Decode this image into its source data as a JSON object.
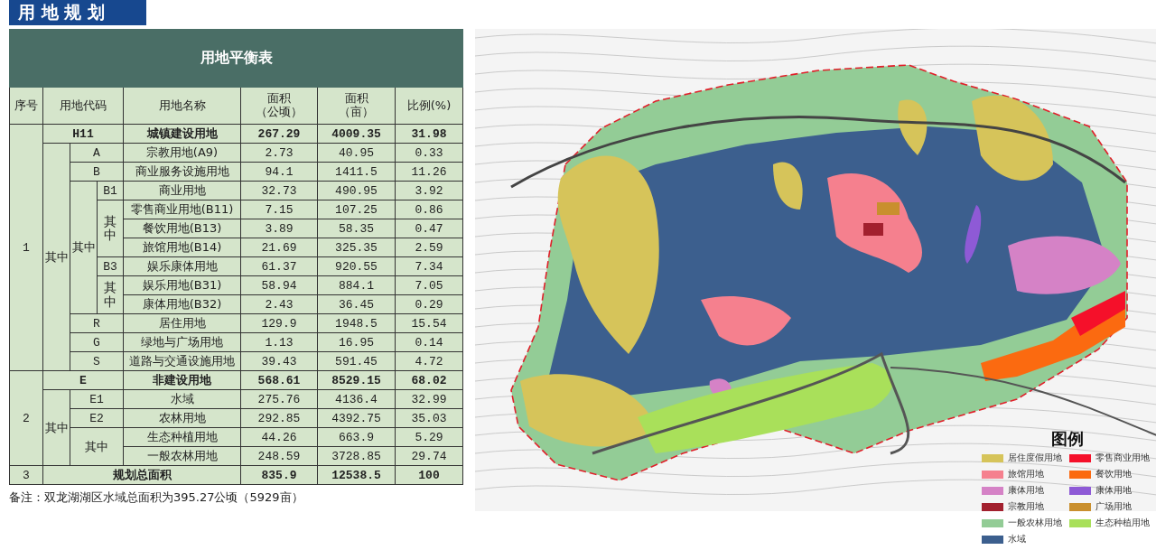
{
  "section_tab": {
    "title": "用 地 规 划"
  },
  "table": {
    "title": "用地平衡表",
    "columns": [
      {
        "label": "序号"
      },
      {
        "label": "用地代码"
      },
      {
        "label": "用地名称"
      },
      {
        "label": "面积",
        "unit": "（公顷）"
      },
      {
        "label": "面积",
        "unit": "（亩）"
      },
      {
        "label": "比例(%)"
      }
    ],
    "sections": [
      {
        "no": "1",
        "code": "H11",
        "name": "城镇建设用地",
        "area_ha": "267.29",
        "area_mu": "4009.35",
        "ratio": "31.98",
        "group_label": "其中",
        "children": [
          {
            "code": "A",
            "name": "宗教用地(A9)",
            "area_ha": "2.73",
            "area_mu": "40.95",
            "ratio": "0.33"
          },
          {
            "code": "B",
            "name": "商业服务设施用地",
            "area_ha": "94.1",
            "area_mu": "1411.5",
            "ratio": "11.26",
            "group_label": "其中",
            "children": [
              {
                "code": "B1",
                "name": "商业用地",
                "area_ha": "32.73",
                "area_mu": "490.95",
                "ratio": "3.92",
                "group_label": "其中",
                "children": [
                  {
                    "name": "零售商业用地(B11)",
                    "area_ha": "7.15",
                    "area_mu": "107.25",
                    "ratio": "0.86"
                  },
                  {
                    "name": "餐饮用地(B13)",
                    "area_ha": "3.89",
                    "area_mu": "58.35",
                    "ratio": "0.47"
                  },
                  {
                    "name": "旅馆用地(B14)",
                    "area_ha": "21.69",
                    "area_mu": "325.35",
                    "ratio": "2.59"
                  }
                ]
              },
              {
                "code": "B3",
                "name": "娱乐康体用地",
                "area_ha": "61.37",
                "area_mu": "920.55",
                "ratio": "7.34",
                "group_label": "其中",
                "children": [
                  {
                    "name": "娱乐用地(B31)",
                    "area_ha": "58.94",
                    "area_mu": "884.1",
                    "ratio": "7.05"
                  },
                  {
                    "name": "康体用地(B32)",
                    "area_ha": "2.43",
                    "area_mu": "36.45",
                    "ratio": "0.29"
                  }
                ]
              }
            ]
          },
          {
            "code": "R",
            "name": "居住用地",
            "area_ha": "129.9",
            "area_mu": "1948.5",
            "ratio": "15.54"
          },
          {
            "code": "G",
            "name": "绿地与广场用地",
            "area_ha": "1.13",
            "area_mu": "16.95",
            "ratio": "0.14"
          },
          {
            "code": "S",
            "name": "道路与交通设施用地",
            "area_ha": "39.43",
            "area_mu": "591.45",
            "ratio": "4.72"
          }
        ]
      },
      {
        "no": "2",
        "code": "E",
        "name": "非建设用地",
        "area_ha": "568.61",
        "area_mu": "8529.15",
        "ratio": "68.02",
        "group_label": "其中",
        "children": [
          {
            "code": "E1",
            "name": "水域",
            "area_ha": "275.76",
            "area_mu": "4136.4",
            "ratio": "32.99"
          },
          {
            "code": "E2",
            "name": "农林用地",
            "area_ha": "292.85",
            "area_mu": "4392.75",
            "ratio": "35.03",
            "group_label": "其中",
            "children": [
              {
                "name": "生态种植用地",
                "area_ha": "44.26",
                "area_mu": "663.9",
                "ratio": "5.29"
              },
              {
                "name": "一般农林用地",
                "area_ha": "248.59",
                "area_mu": "3728.85",
                "ratio": "29.74"
              }
            ]
          }
        ]
      }
    ],
    "total": {
      "no": "3",
      "name": "规划总面积",
      "area_ha": "835.9",
      "area_mu": "12538.5",
      "ratio": "100"
    }
  },
  "note": "备注：双龙湖湖区水域总面积为395.27公顷（5929亩）",
  "legend": {
    "title": "图例",
    "items": [
      {
        "label": "居住度假用地",
        "color": "#d6c45a"
      },
      {
        "label": "零售商业用地",
        "color": "#f5102a"
      },
      {
        "label": "旅馆用地",
        "color": "#f5808e"
      },
      {
        "label": "餐饮用地",
        "color": "#fb6a10"
      },
      {
        "label": "康体用地",
        "color": "#d582c6"
      },
      {
        "label": "康体用地",
        "color": "#8e5ad6"
      },
      {
        "label": "宗教用地",
        "color": "#a2202e"
      },
      {
        "label": "广场用地",
        "color": "#c98f2e"
      },
      {
        "label": "一般农林用地",
        "color": "#93cc96"
      },
      {
        "label": "生态种植用地",
        "color": "#a9e05a"
      },
      {
        "label": "水域",
        "color": "#3c5f8e"
      }
    ]
  }
}
